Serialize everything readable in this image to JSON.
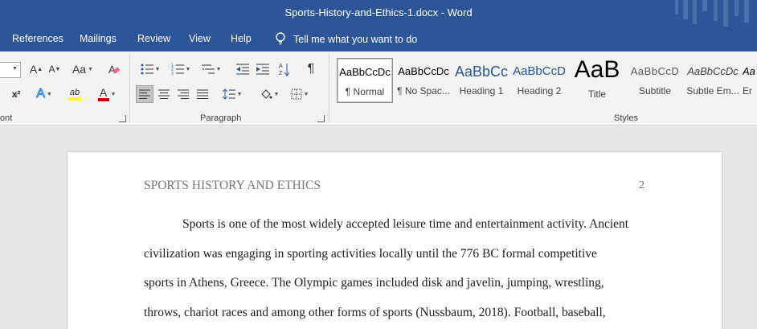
{
  "window": {
    "title": "Sports-History-and-Ethics-1.docx  -  Word"
  },
  "menu": {
    "tabs": [
      "References",
      "Mailings",
      "Review",
      "View",
      "Help"
    ],
    "tell_me": "Tell me what you want to do"
  },
  "ribbon": {
    "groups": {
      "font": "ont",
      "paragraph": "Paragraph",
      "styles": "Styles"
    },
    "font_buttons": {
      "grow": "A",
      "shrink": "A",
      "case": "Aa",
      "superscript": "x²",
      "text_effects": "A",
      "highlight": "ab",
      "font_color": "A"
    },
    "paragraph_buttons": {
      "show_marks": "¶"
    },
    "styles": [
      {
        "preview": "AaBbCcDc",
        "name": "¶ Normal"
      },
      {
        "preview": "AaBbCcDc",
        "name": "¶ No Spac..."
      },
      {
        "preview": "AaBbCc",
        "name": "Heading 1"
      },
      {
        "preview": "AaBbCcD",
        "name": "Heading 2"
      },
      {
        "preview": "AaB",
        "name": "Title"
      },
      {
        "preview": "AaBbCcD",
        "name": "Subtitle"
      },
      {
        "preview": "AaBbCcDc",
        "name": "Subtle Em..."
      },
      {
        "preview": "Aa",
        "name": "Er"
      }
    ]
  },
  "document": {
    "header": "SPORTS HISTORY AND ETHICS",
    "page_number": "2",
    "lines": [
      "Sports is one of the most widely accepted leisure time and entertainment activity. Ancient",
      "civilization was engaging in sporting activities locally until the 776 BC formal competitive",
      "sports in Athens, Greece. The Olympic games included disk and javelin, jumping, wrestling,",
      "throws, chariot races and among other forms of sports (Nussbaum, 2018). Football, baseball,"
    ]
  },
  "colors": {
    "accent": "#2b579a",
    "font_color_bar": "#c00000",
    "highlight_bar": "#ffff00"
  }
}
